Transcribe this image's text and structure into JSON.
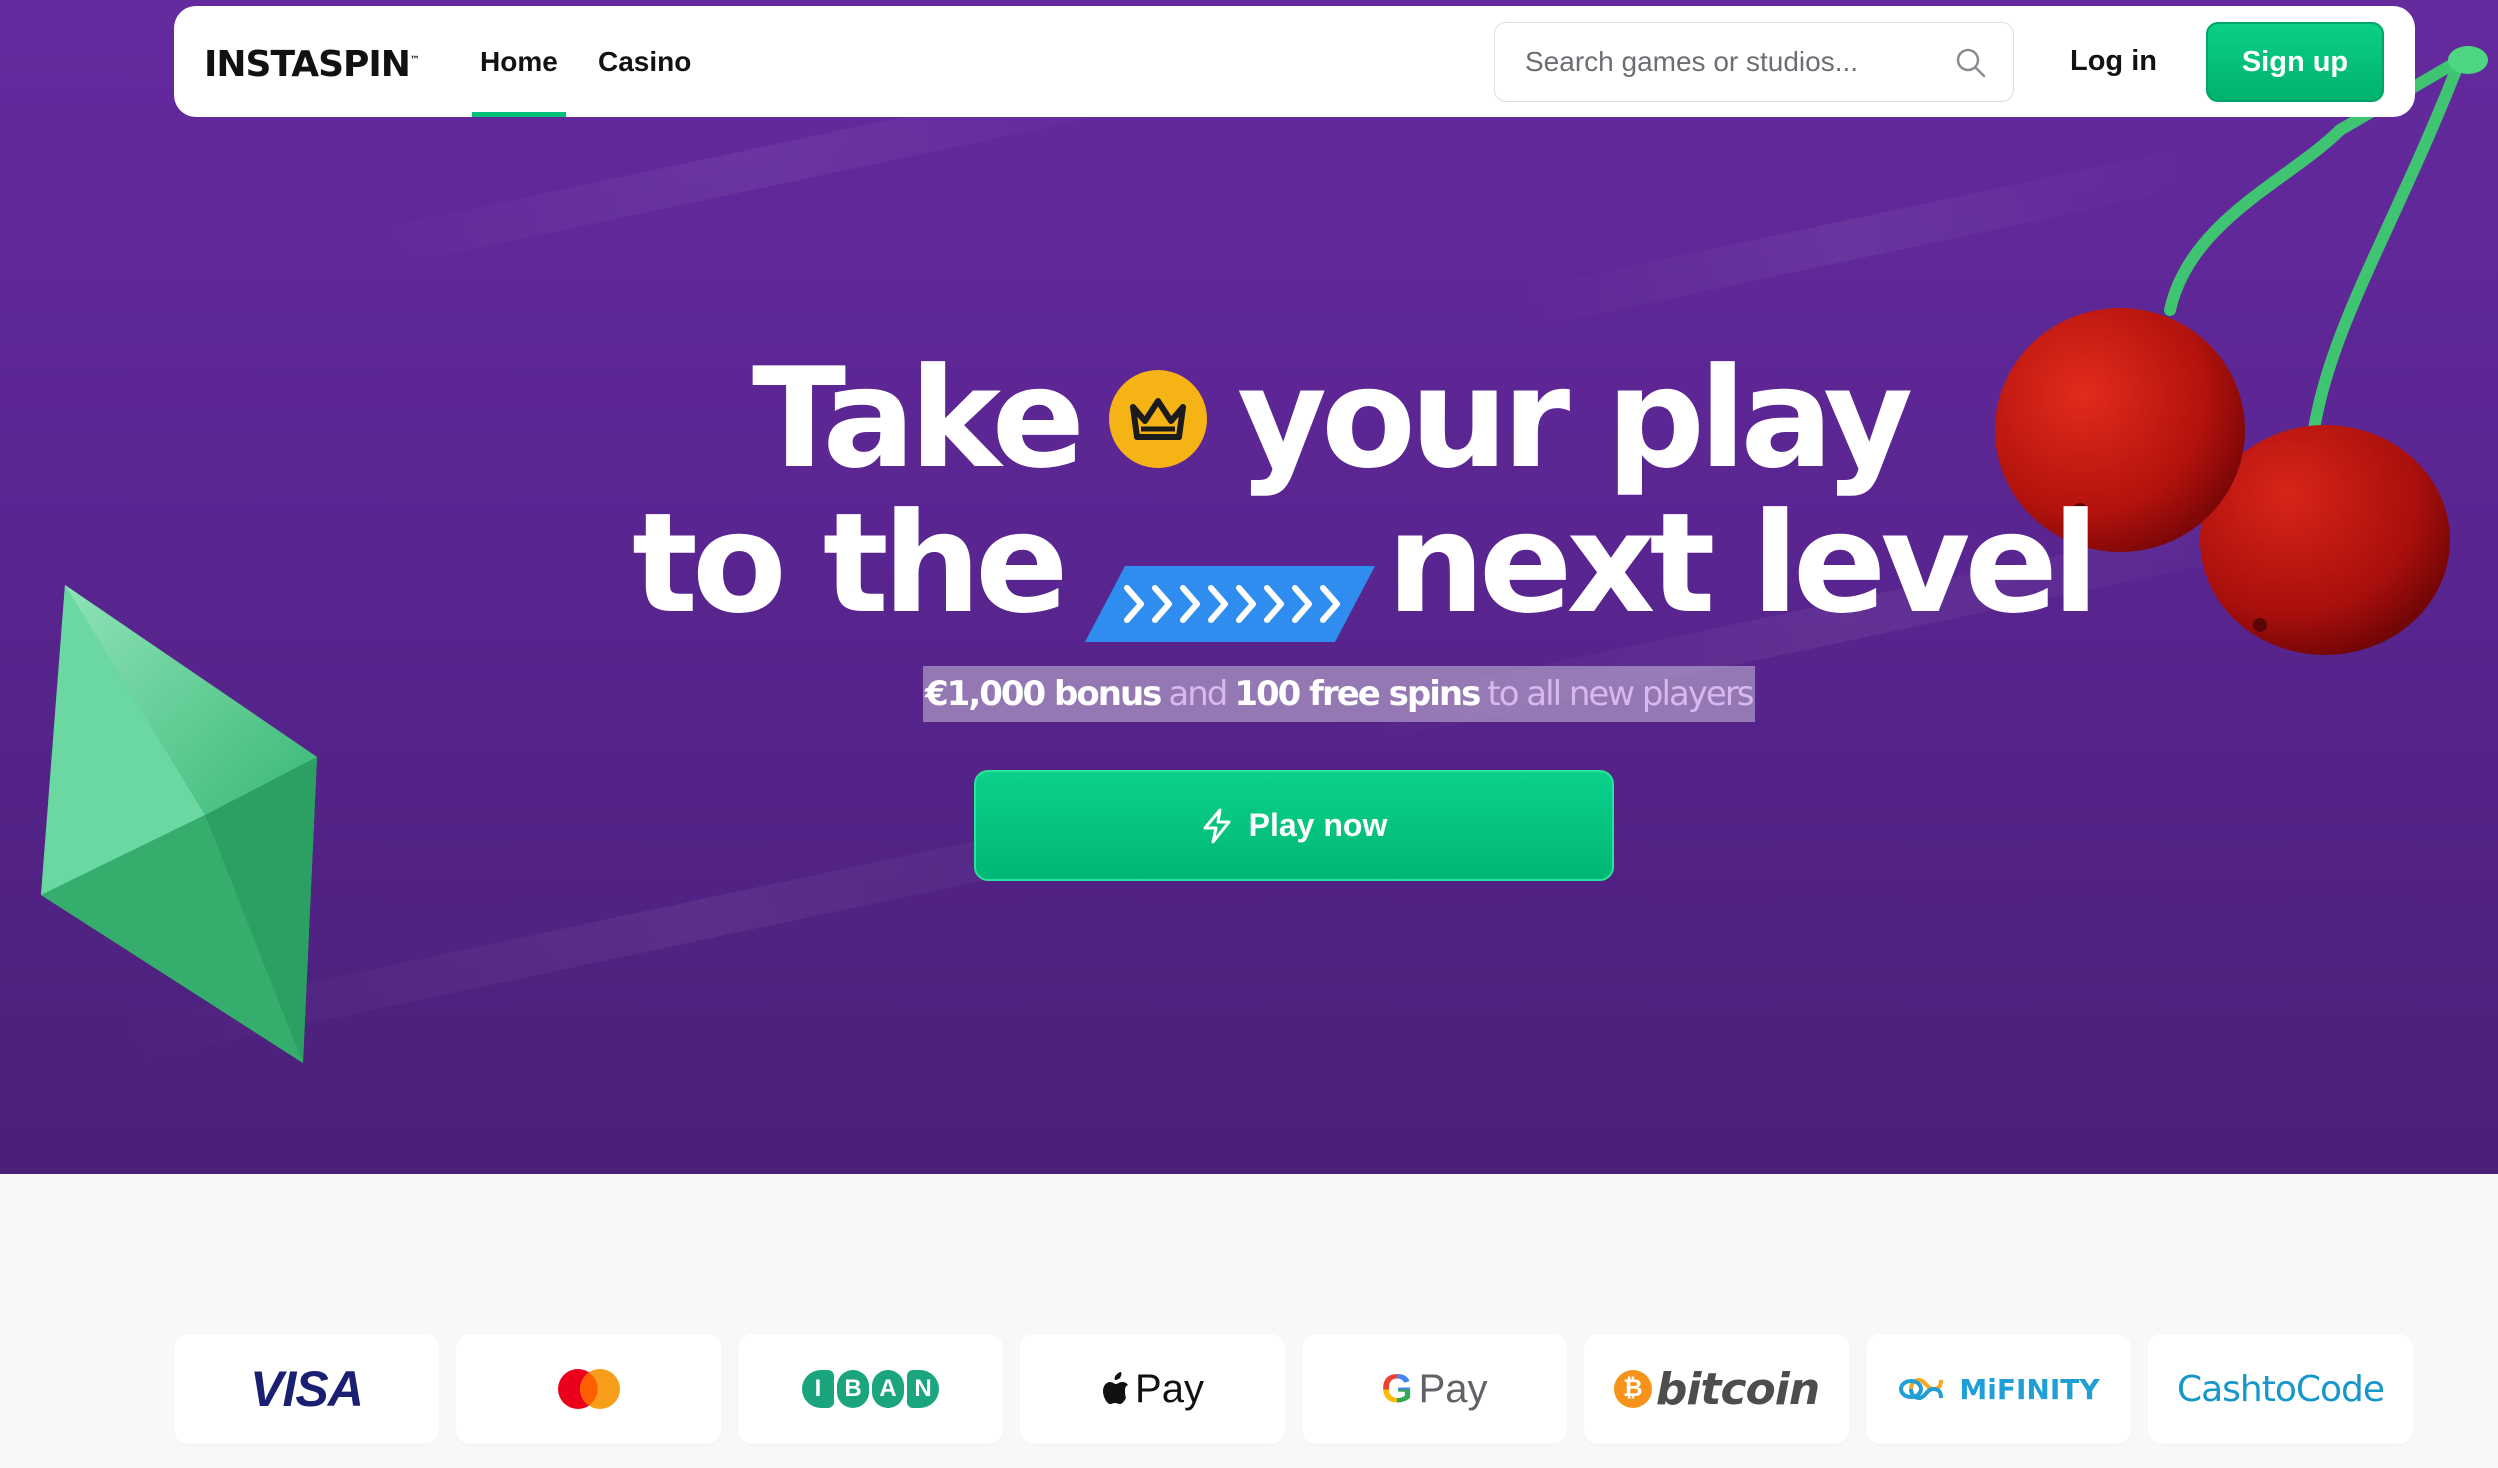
{
  "nav": {
    "logo": "INSTASPIN",
    "logo_mark": "™",
    "links": [
      {
        "label": "Home",
        "active": true
      },
      {
        "label": "Casino",
        "active": false
      }
    ],
    "search": {
      "placeholder": "Search games or studios...",
      "value": "",
      "icon": "search-icon"
    },
    "login_label": "Log in",
    "signup_label": "Sign up"
  },
  "hero": {
    "line1_before": "Take",
    "line1_after": "your play",
    "line2_before": "to the",
    "line2_after": "next level",
    "badge_icons": [
      "crown-icon",
      "chevron-arrows-icon"
    ],
    "promo": {
      "bonus": "€1,000 bonus",
      "and": "and",
      "spins": "100 free spins",
      "rest": "to all new players"
    },
    "cta_label": "Play now",
    "cta_icon": "lightning-icon"
  },
  "payments": [
    {
      "name": "visa",
      "label": "VISA"
    },
    {
      "name": "mastercard",
      "label": ""
    },
    {
      "name": "iban",
      "letters": [
        "I",
        "B",
        "A",
        "N"
      ]
    },
    {
      "name": "applepay",
      "label": "Pay"
    },
    {
      "name": "googlepay",
      "g": "G",
      "label": "Pay"
    },
    {
      "name": "bitcoin",
      "symbol": "₿",
      "label": "bitcoin"
    },
    {
      "name": "mifinity",
      "label": "MiFINITY"
    },
    {
      "name": "cashtocode",
      "label": "CashtoCode"
    }
  ],
  "colors": {
    "brand_green": "#04c07a",
    "hero_purple": "#5a2591",
    "crown_yellow": "#f6b315",
    "arrow_blue": "#2f8df0"
  }
}
